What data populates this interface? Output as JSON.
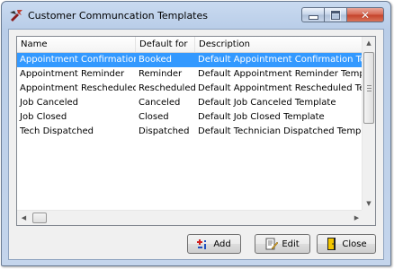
{
  "window": {
    "title": "Customer Communcation Templates"
  },
  "list": {
    "columns": [
      "Name",
      "Default for",
      "Description"
    ],
    "rows": [
      {
        "name": "Appointment Confirmation",
        "default_for": "Booked",
        "description": "Default Appointment Confirmation Temp",
        "selected": true
      },
      {
        "name": "Appointment Reminder",
        "default_for": "Reminder",
        "description": "Default Appointment Reminder Templat",
        "selected": false
      },
      {
        "name": "Appointment Rescheduled",
        "default_for": "Rescheduled",
        "description": "Default Appointment Rescheduled Temp",
        "selected": false
      },
      {
        "name": "Job Canceled",
        "default_for": "Canceled",
        "description": "Default Job Canceled Template",
        "selected": false
      },
      {
        "name": "Job Closed",
        "default_for": "Closed",
        "description": "Default Job Closed Template",
        "selected": false
      },
      {
        "name": "Tech Dispatched",
        "default_for": "Dispatched",
        "description": "Default Technician Dispatched Template",
        "selected": false
      }
    ]
  },
  "buttons": {
    "add_label": "Add",
    "edit_label": "Edit",
    "close_label": "Close"
  },
  "colors": {
    "selection": "#3399ff",
    "title_bar": "#c9daf0",
    "close_button": "#c4412a"
  },
  "icons": {
    "app": "red-wrench-icon",
    "add": "add-item-icon",
    "edit": "edit-document-icon",
    "close": "exit-door-icon"
  }
}
